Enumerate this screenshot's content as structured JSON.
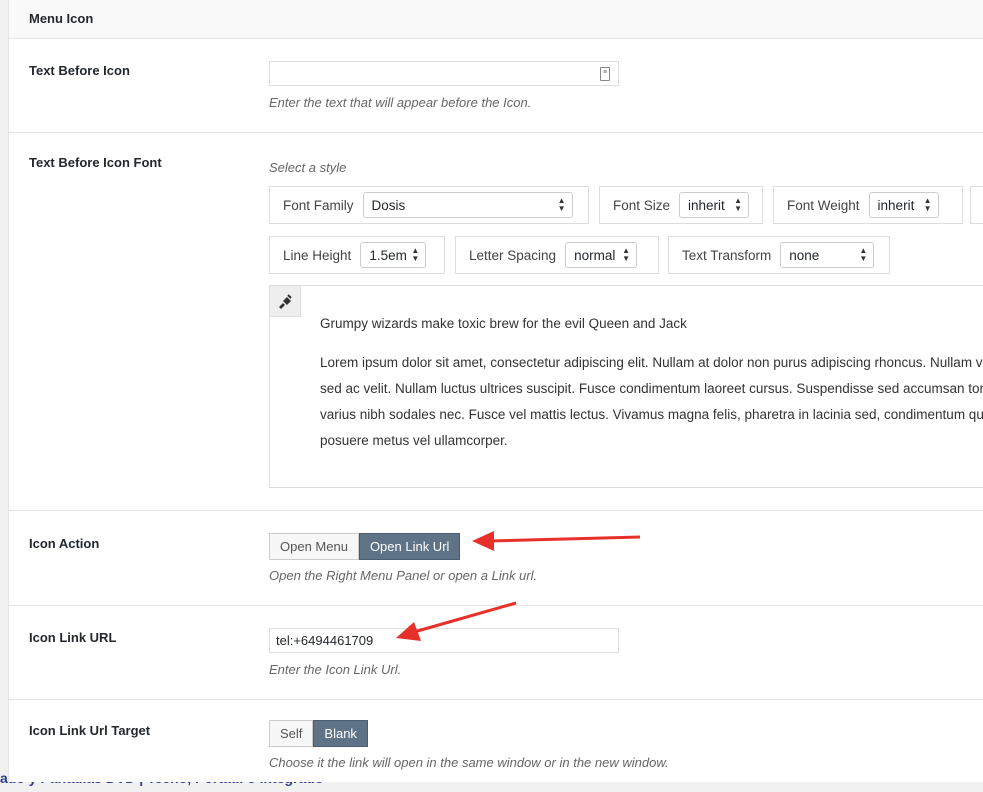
{
  "section": {
    "title": "Menu Icon"
  },
  "text_before_icon": {
    "label": "Text Before Icon",
    "value": "",
    "description": "Enter the text that will appear before the Icon."
  },
  "text_before_icon_font": {
    "label": "Text Before Icon Font",
    "select_hint": "Select a style",
    "font_family": {
      "label": "Font Family",
      "value": "Dosis"
    },
    "font_size": {
      "label": "Font Size",
      "value": "inherit"
    },
    "font_weight": {
      "label": "Font Weight",
      "value": "inherit"
    },
    "line_height": {
      "label": "Line Height",
      "value": "1.5em"
    },
    "letter_spacing": {
      "label": "Letter Spacing",
      "value": "normal"
    },
    "text_transform": {
      "label": "Text Transform",
      "value": "none"
    },
    "preview": {
      "headline": "Grumpy wizards make toxic brew for the evil Queen and Jack",
      "lines": [
        "Lorem ipsum dolor sit amet, consectetur adipiscing elit. Nullam at dolor non purus adipiscing rhoncus. Nullam v",
        "sed ac velit. Nullam luctus ultrices suscipit. Fusce condimentum laoreet cursus. Suspendisse sed accumsan tort",
        "varius nibh sodales nec. Fusce vel mattis lectus. Vivamus magna felis, pharetra in lacinia sed, condimentum quis",
        "posuere metus vel ullamcorper."
      ]
    }
  },
  "icon_action": {
    "label": "Icon Action",
    "options": [
      "Open Menu",
      "Open Link Url"
    ],
    "selected": "Open Link Url",
    "description": "Open the Right Menu Panel or open a Link url."
  },
  "icon_link_url": {
    "label": "Icon Link URL",
    "value": "tel:+6494461709",
    "description": "Enter the Icon Link Url."
  },
  "icon_link_url_target": {
    "label": "Icon Link Url Target",
    "options": [
      "Self",
      "Blank"
    ],
    "selected": "Blank",
    "description": "Choose it the link will open in the same window or in the new window."
  },
  "background_text": "ado y Pantallas DVD | Techo, Portatil o Integrado",
  "colors": {
    "active_button": "#5e7385",
    "arrow": "#e8302a",
    "panel": "#ffffff",
    "page_bg": "#f1f1f1"
  }
}
